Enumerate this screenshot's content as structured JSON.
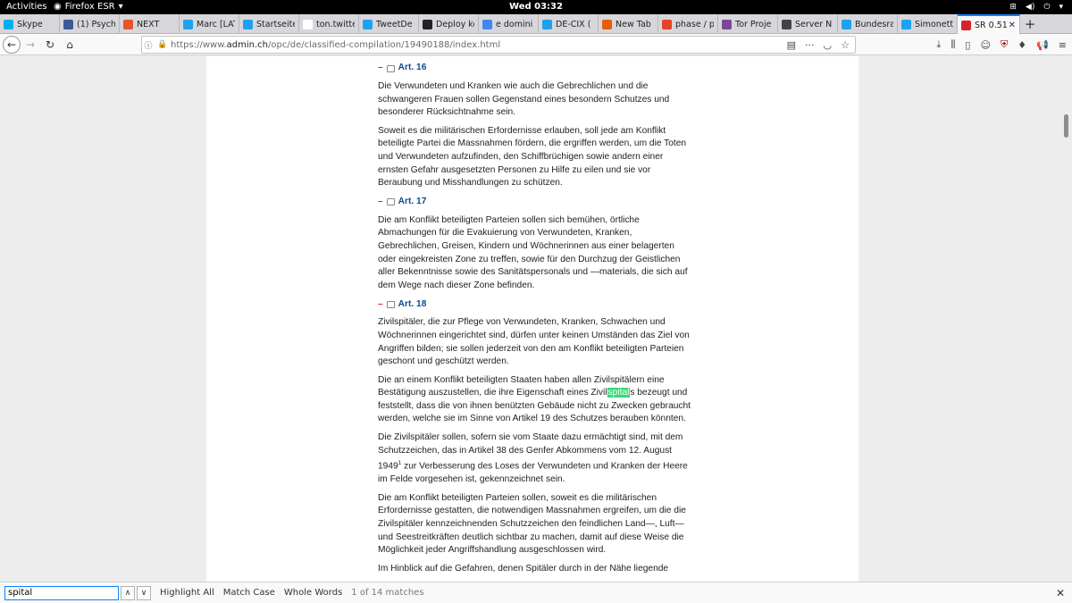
{
  "topbar": {
    "activities": "Activities",
    "app_name": "Firefox ESR",
    "clock": "Wed 03:32"
  },
  "tabs": [
    {
      "title": "Skype",
      "color": "#00aff0"
    },
    {
      "title": "(1) Psycho",
      "color": "#3b5998"
    },
    {
      "title": "NEXT",
      "color": "#e8542c"
    },
    {
      "title": "Marc [LAT",
      "color": "#1da1f2"
    },
    {
      "title": "Startseite",
      "color": "#1da1f2"
    },
    {
      "title": "ton.twitter.co",
      "color": "#ffffff"
    },
    {
      "title": "TweetDe",
      "color": "#1da1f2"
    },
    {
      "title": "Deploy ke",
      "color": "#222222"
    },
    {
      "title": "e domini",
      "color": "#4285f4"
    },
    {
      "title": "DE-CIX (",
      "color": "#1da1f2"
    },
    {
      "title": "New Tab",
      "color": "#e66000"
    },
    {
      "title": "phase / p",
      "color": "#e24329"
    },
    {
      "title": "Tor Proje",
      "color": "#7d4698"
    },
    {
      "title": "Server N",
      "color": "#444444"
    },
    {
      "title": "Bundesra",
      "color": "#1da1f2"
    },
    {
      "title": "Simonetta",
      "color": "#1da1f2"
    },
    {
      "title": "SR 0.51",
      "color": "#d8232a",
      "active": true
    }
  ],
  "url": {
    "prefix": "https://www.",
    "host": "admin.ch",
    "path": "/opc/de/classified-compilation/19490188/index.html"
  },
  "article": {
    "art16": {
      "heading": "Art. 16",
      "p1": "Die Verwundeten und Kranken wie auch die Gebrechlichen und die schwangeren Frauen sollen Gegenstand eines besondern Schutzes und besonderer Rücksichtnahme sein.",
      "p2": "Soweit es die militärischen Erfordernisse erlauben, soll jede am Konflikt beteiligte Partei die Massnahmen fördern, die ergriffen werden, um die Toten und Verwundeten aufzufinden, den Schiffbrüchigen sowie andern einer ernsten Gefahr ausgesetzten Personen zu Hilfe zu eilen und sie vor Beraubung und Misshandlungen zu schützen."
    },
    "art17": {
      "heading": "Art. 17",
      "p1": "Die am Konflikt beteiligten Parteien sollen sich bemühen, örtliche Abmachungen für die Evakuierung von Verwundeten, Kranken, Gebrechlichen, Greisen, Kindern und Wöchnerinnen aus einer belagerten oder eingekreisten Zone zu treffen, sowie für den Durchzug der Geistlichen aller Bekenntnisse sowie des Sanitätspersonals und —materials, die sich auf dem Wege nach dieser Zone befinden."
    },
    "art18": {
      "heading": "Art. 18",
      "p1": "Zivilspitäler, die zur Pflege von Verwundeten, Kranken, Schwachen und Wöchnerinnen eingerichtet sind, dürfen unter keinen Umständen das Ziel von Angriffen bilden; sie sollen jederzeit von den am Konflikt beteiligten Parteien geschont und geschützt werden.",
      "p2_before": "Die an einem Konflikt beteiligten Staaten haben allen Zivilspitälern eine Bestätigung auszustellen, die ihre Eigenschaft eines Zivil",
      "p2_match": "spital",
      "p2_after": "s bezeugt und feststellt, dass die von ihnen benützten Gebäude nicht zu Zwecken gebraucht werden, welche sie im Sinne von Artikel 19 des Schutzes berauben könnten.",
      "p3_before": "Die Zivilspitäler sollen, sofern sie vom Staate dazu ermächtigt sind, mit dem Schutzzeichen, das in Artikel 38 des Genfer Abkommens vom 12. August 1949",
      "p3_sup": "1",
      "p3_after": " zur Verbesserung des Loses der Verwundeten und Kranken der Heere im Felde vorgesehen ist, gekennzeichnet sein.",
      "p4": "Die am Konflikt beteiligten Parteien sollen, soweit es die militärischen Erfordernisse gestatten, die notwendigen Massnahmen ergreifen, um die die Zivilspitäler kennzeichnenden Schutzzeichen den feindlichen Land—, Luft— und Seestreitkräften deutlich sichtbar zu machen, damit auf diese Weise die Möglichkeit jeder Angriffshandlung ausgeschlossen wird.",
      "p5": "Im Hinblick auf die Gefahren, denen Spitäler durch in der Nähe liegende"
    }
  },
  "findbar": {
    "query": "spital",
    "highlight_all": "Highlight All",
    "match_case": "Match Case",
    "whole_words": "Whole Words",
    "status": "1 of 14 matches"
  }
}
